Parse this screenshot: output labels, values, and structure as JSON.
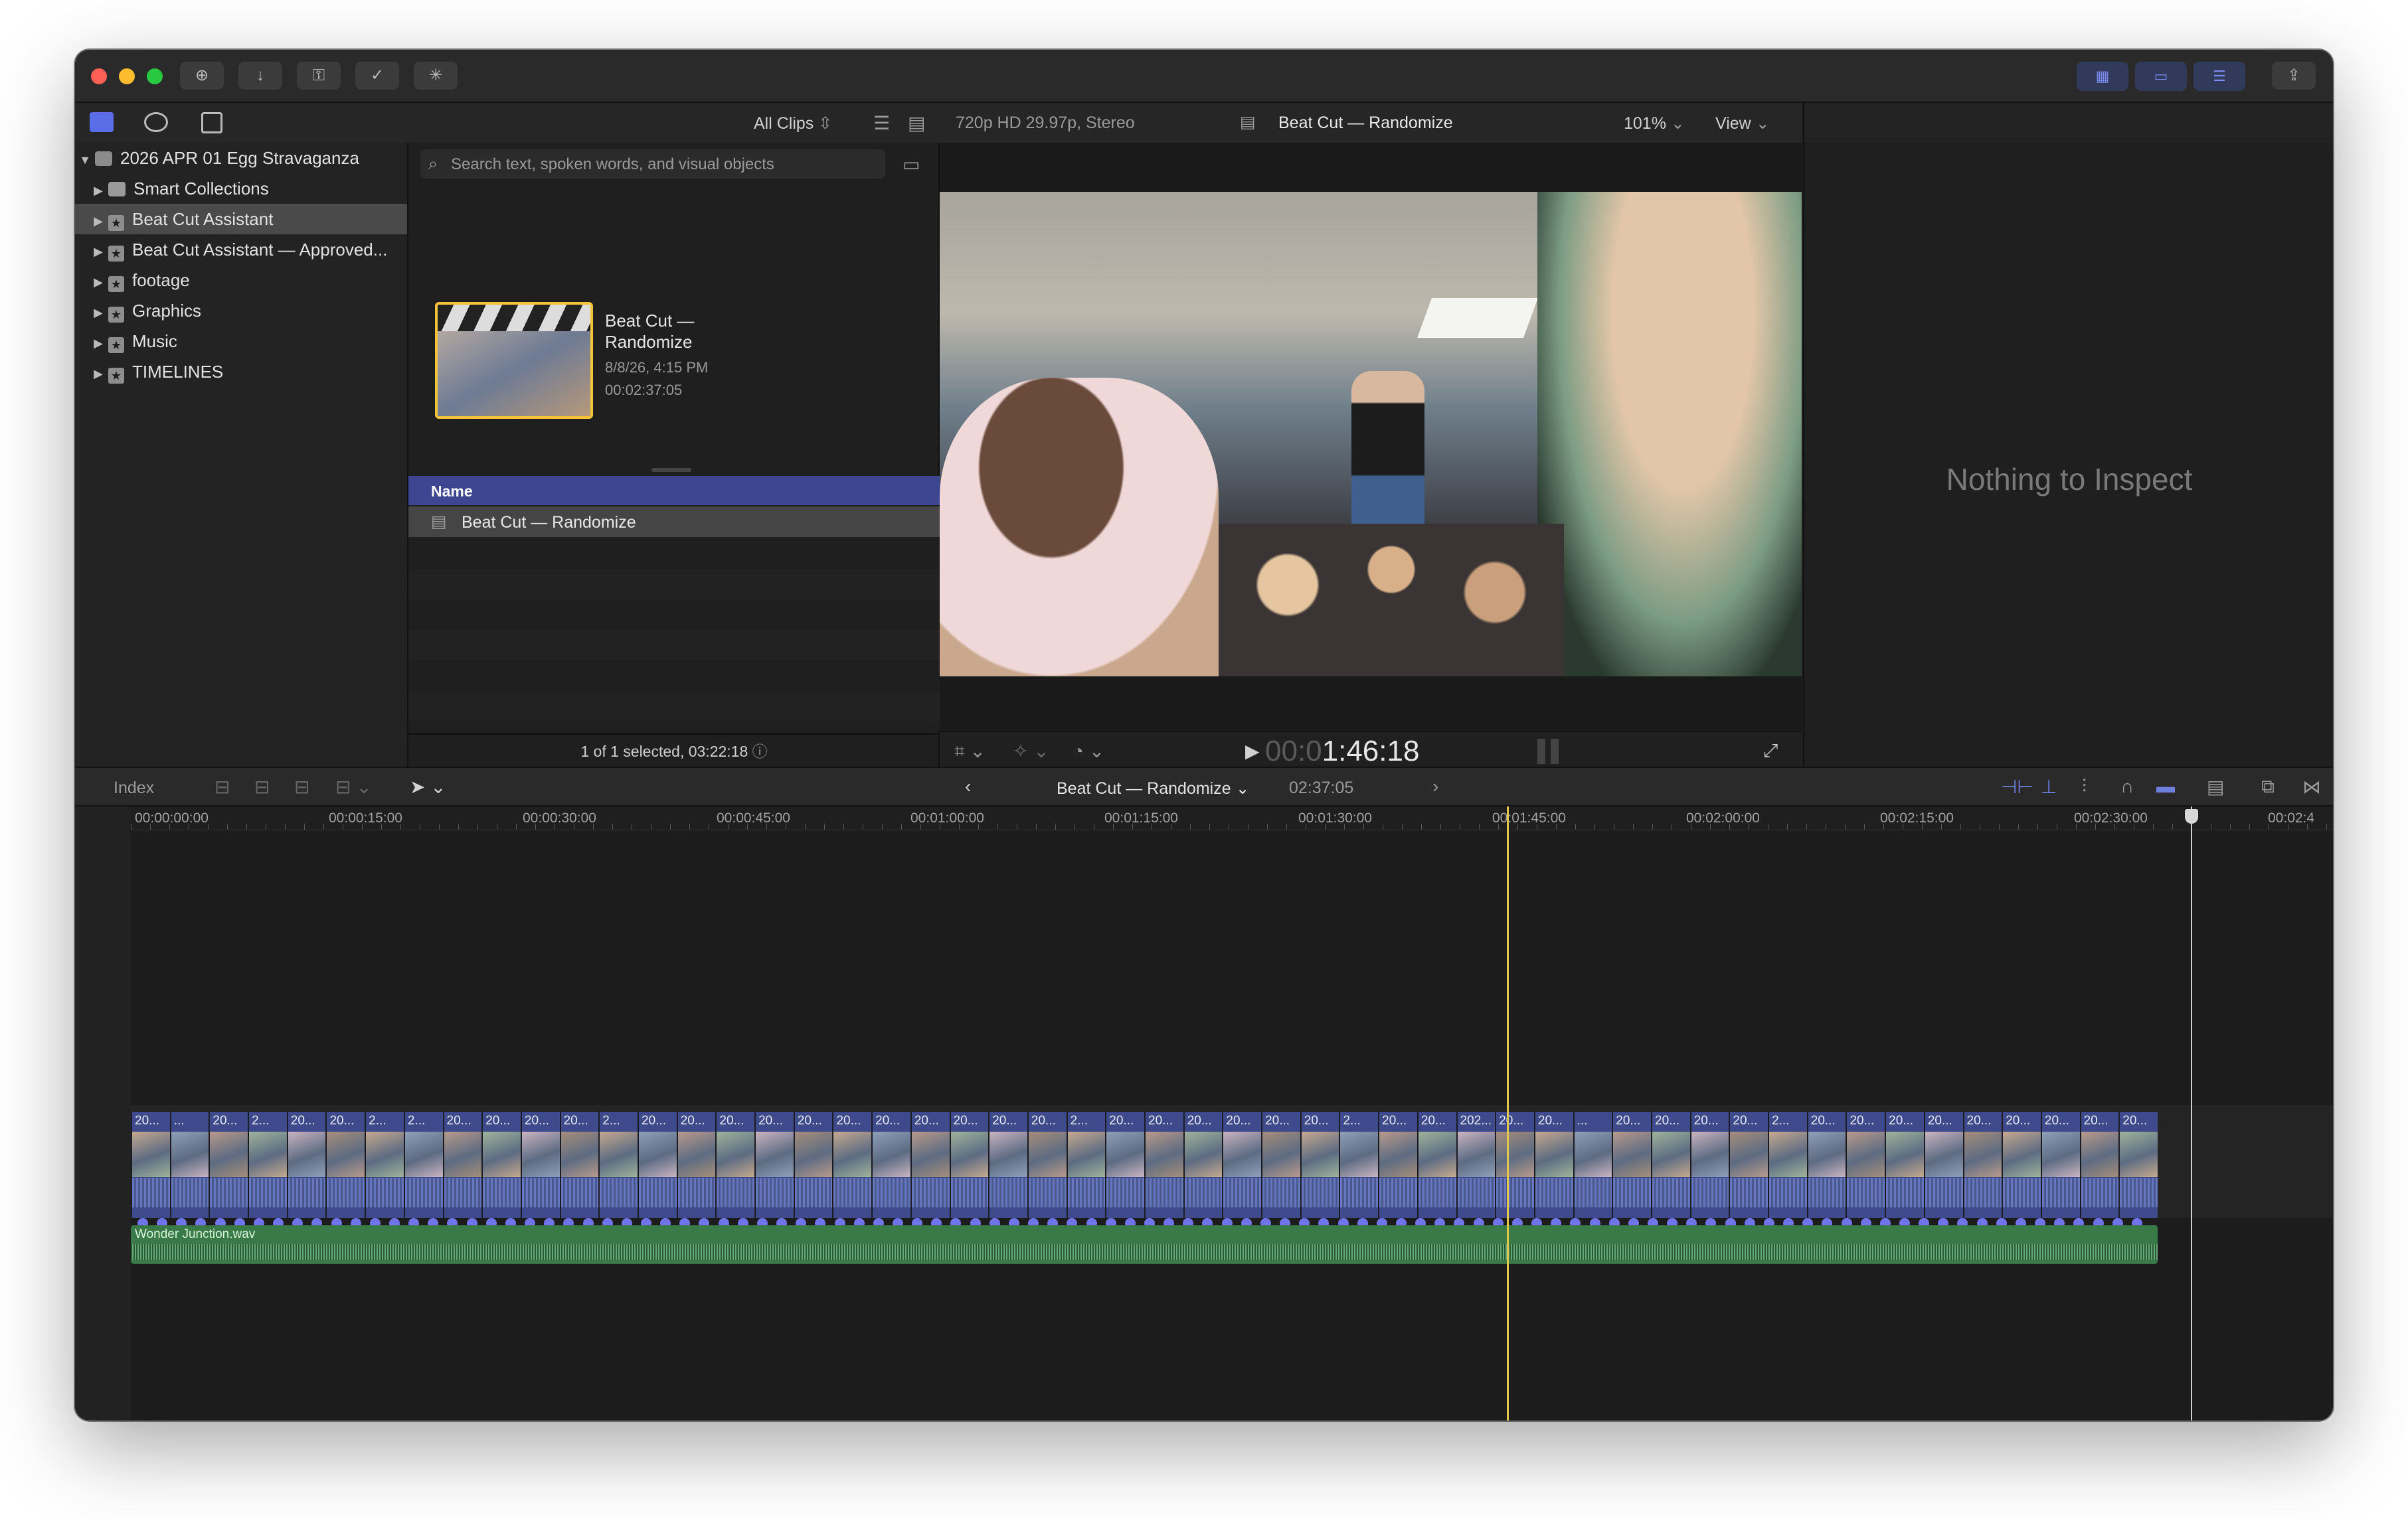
{
  "toolbar": {
    "buttons": [
      "add-icon",
      "import-icon",
      "key-icon",
      "checkmark-icon",
      "sparkle-icon"
    ],
    "right_buttons": [
      "browser-toggle-icon",
      "timeline-toggle-icon",
      "inspector-toggle-icon"
    ]
  },
  "library": {
    "root": "2026 APR 01 Egg Stravaganza",
    "items": [
      {
        "label": "Smart Collections",
        "type": "folder"
      },
      {
        "label": "Beat Cut Assistant",
        "type": "event",
        "selected": true
      },
      {
        "label": "Beat Cut Assistant — Approved...",
        "type": "event"
      },
      {
        "label": "footage",
        "type": "event"
      },
      {
        "label": "Graphics",
        "type": "event"
      },
      {
        "label": "Music",
        "type": "event"
      },
      {
        "label": "TIMELINES",
        "type": "event"
      }
    ]
  },
  "browser": {
    "filter": "All Clips",
    "search_placeholder": "Search text, spoken words, and visual objects",
    "clip": {
      "title_line1": "Beat Cut —",
      "title_line2": "Randomize",
      "date": "8/8/26, 4:15 PM",
      "duration": "00:02:37:05"
    },
    "list_header": "Name",
    "list_row": "Beat Cut — Randomize",
    "status": "1 of 1 selected, 03:22:18"
  },
  "viewer": {
    "format": "720p HD 29.97p, Stereo",
    "title": "Beat Cut — Randomize",
    "zoom": "101%",
    "view_label": "View",
    "timecode_dim": "00:0",
    "timecode": "1:46:18"
  },
  "inspector": {
    "empty_text": "Nothing to Inspect"
  },
  "timeline": {
    "index_label": "Index",
    "project_name": "Beat Cut — Randomize",
    "project_duration": "02:37:05",
    "ruler": [
      "00:00:00:00",
      "00:00:15:00",
      "00:00:30:00",
      "00:00:45:00",
      "00:01:00:00",
      "00:01:15:00",
      "00:01:30:00",
      "00:01:45:00",
      "00:02:00:00",
      "00:02:15:00",
      "00:02:30:00",
      "00:02:4"
    ],
    "clip_labels": [
      "20...",
      "...",
      "20...",
      "2...",
      "20...",
      "20...",
      "2...",
      "2...",
      "20...",
      "20...",
      "20...",
      "20...",
      "2...",
      "20...",
      "20...",
      "20...",
      "20...",
      "20...",
      "20...",
      "20...",
      "20...",
      "20...",
      "20...",
      "20...",
      "2...",
      "20...",
      "20...",
      "20...",
      "20...",
      "20...",
      "20...",
      "2...",
      "20...",
      "20...",
      "202...",
      "20...",
      "20...",
      "...",
      "20...",
      "20...",
      "20...",
      "20...",
      "2...",
      "20...",
      "20...",
      "20...",
      "20...",
      "20...",
      "20...",
      "20...",
      "20...",
      "20..."
    ],
    "audio_clip": "Wonder Junction.wav"
  }
}
